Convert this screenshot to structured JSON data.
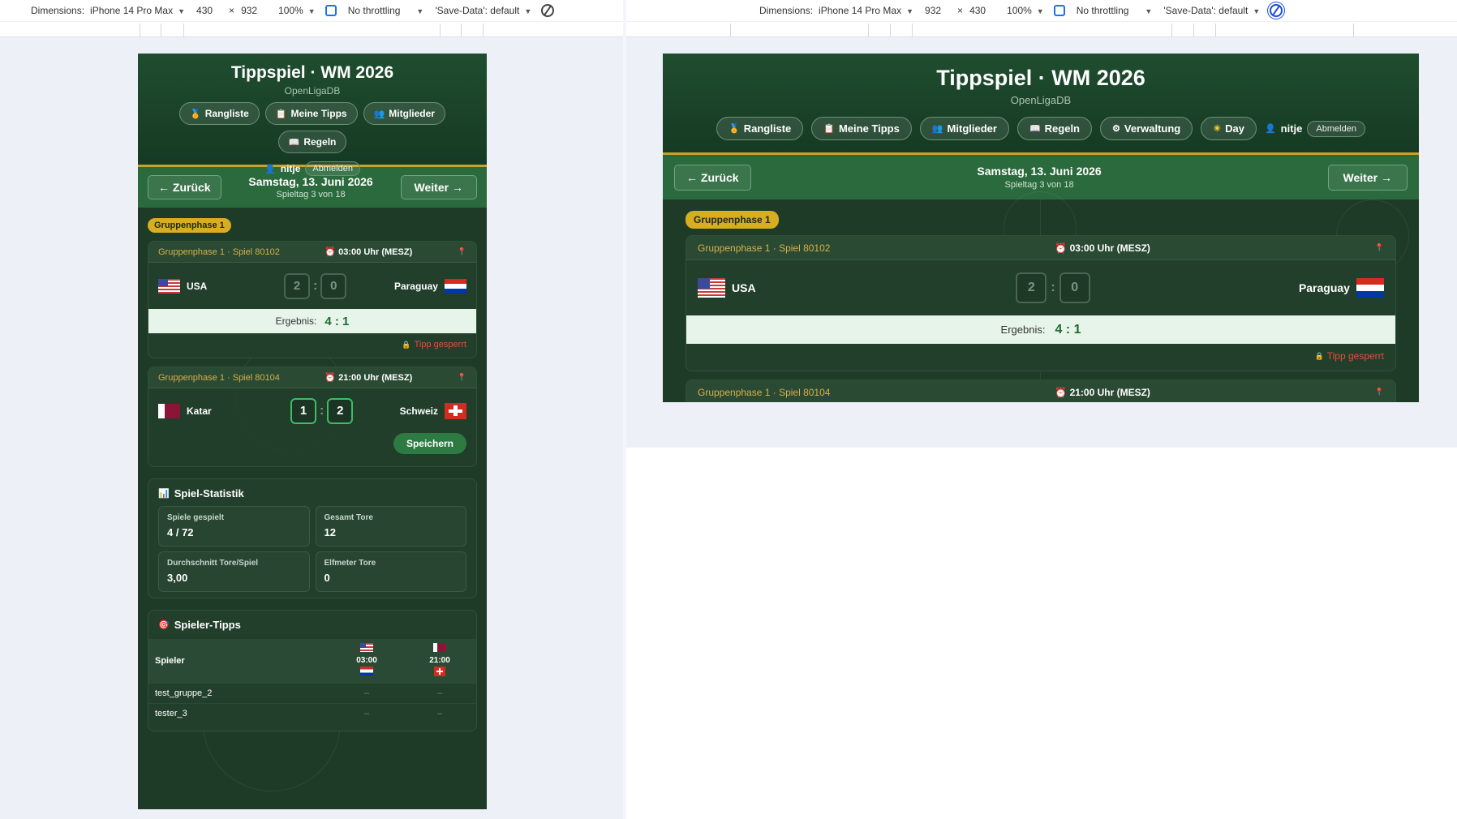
{
  "devtools": {
    "dimensions_label": "Dimensions:",
    "device": "iPhone 14 Pro Max",
    "left": {
      "width": "430",
      "height": "932"
    },
    "right": {
      "width": "932",
      "height": "430"
    },
    "times": "×",
    "zoom": "100%",
    "throttling": "No throttling",
    "save_data": "'Save-Data': default"
  },
  "app": {
    "title": "Tippspiel · WM 2026",
    "subtitle": "OpenLigaDB",
    "nav": [
      {
        "icon": "🏅",
        "label": "Rangliste"
      },
      {
        "icon": "📋",
        "label": "Meine Tipps"
      },
      {
        "icon": "👥",
        "label": "Mitglieder"
      },
      {
        "icon": "📖",
        "label": "Regeln"
      },
      {
        "icon": "⚙",
        "label": "Verwaltung"
      },
      {
        "icon": "☀",
        "label": "Day"
      }
    ],
    "user_icon": "👤",
    "username": "nitje",
    "logout": "Abmelden",
    "day_nav": {
      "prev": "← Zurück",
      "next": "Weiter →",
      "date": "Samstag, 13. Juni 2026",
      "matchday": "Spieltag 3 von 18"
    },
    "phase": "Gruppenphase 1",
    "matches": [
      {
        "id_label": "Gruppenphase 1 · Spiel 80102",
        "time_icon": "⏰",
        "time": "03:00 Uhr (MESZ)",
        "pin": "📍",
        "home": "USA",
        "away": "Paraguay",
        "home_score": "2",
        "away_score": "0",
        "result_label": "Ergebnis:",
        "result": "4 : 1",
        "lock_icon": "🔒",
        "locked": "Tipp gesperrt"
      },
      {
        "id_label": "Gruppenphase 1 · Spiel 80104",
        "time_icon": "⏰",
        "time": "21:00 Uhr (MESZ)",
        "pin": "📍",
        "home": "Katar",
        "away": "Schweiz",
        "home_score": "1",
        "away_score": "2",
        "save": "Speichern"
      }
    ],
    "stats": {
      "icon": "📊",
      "title": "Spiel-Statistik",
      "items": [
        {
          "label": "Spiele gespielt",
          "value": "4 / 72"
        },
        {
          "label": "Gesamt Tore",
          "value": "12"
        },
        {
          "label": "Durchschnitt Tore/Spiel",
          "value": "3,00"
        },
        {
          "label": "Elfmeter Tore",
          "value": "0"
        }
      ]
    },
    "tipps": {
      "icon": "🎯",
      "title": "Spieler-Tipps",
      "col_player": "Spieler",
      "col1_time": "03:00",
      "col2_time": "21:00",
      "rows": [
        {
          "name": "test_gruppe_2",
          "t1": "–",
          "t2": "–"
        },
        {
          "name": "tester_3",
          "t1": "–",
          "t2": "–"
        }
      ]
    },
    "colors": {
      "header_green": "#1f4d2f",
      "gold": "#d8ad1f",
      "accent_green": "#3dbd64",
      "locked_red": "#e84d3a"
    }
  }
}
